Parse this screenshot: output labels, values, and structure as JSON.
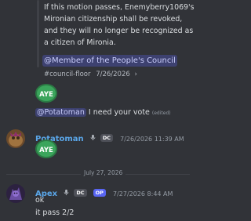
{
  "embed": {
    "body": "If this motion passes, Enemyberry1069's Mironian citizenship shall be revoked, and they will no longer be recognized as a citizen of Mironia.",
    "role_mention": "@Member of the People's Council",
    "channel": "#council-floor",
    "date": "7/26/2026",
    "chevron": "›"
  },
  "reaction_label": "AYE",
  "message_reply": {
    "mention": "@Potatoman",
    "text": "I need your vote",
    "edited": "(edited)"
  },
  "potatoman_message": {
    "username": "Potatoman",
    "badge": "DC",
    "timestamp": "7/26/2026 11:39 AM",
    "username_color": "#5aa6e8"
  },
  "date_divider": "July 27, 2026",
  "apex_message": {
    "username": "Apex",
    "badge": "DC",
    "op_badge": "OP",
    "timestamp": "7/27/2026 8:44 AM",
    "lines": [
      "ok",
      "it pass 2/2"
    ],
    "username_color": "#5aa6e8"
  },
  "colors": {
    "background": "#313338",
    "aye_green": "#3ba55c",
    "mention_bg": "rgba(88,101,242,0.3)"
  }
}
